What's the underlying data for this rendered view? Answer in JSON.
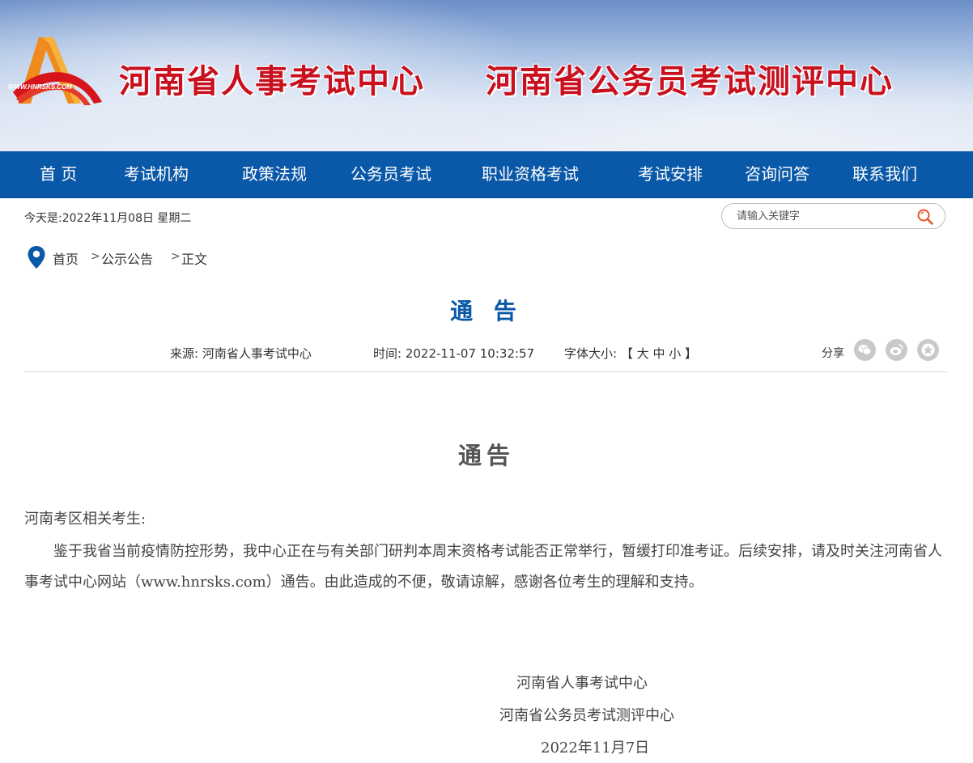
{
  "header": {
    "logo_text": "WWW.HNRSKS.COM",
    "title_1": "河南省人事考试中心",
    "title_2": "河南省公务员考试测评中心"
  },
  "nav": {
    "items": [
      "首 页",
      "考试机构",
      "政策法规",
      "公务员考试",
      "职业资格考试",
      "考试安排",
      "咨询问答",
      "联系我们"
    ]
  },
  "toolbar": {
    "date": "今天是:2022年11月08日 星期二",
    "search_placeholder": "请输入关键字",
    "search_value": ""
  },
  "breadcrumb": {
    "items": [
      "首页",
      "公示公告",
      "正文"
    ],
    "separator": ">"
  },
  "article": {
    "title": "通 告",
    "source": "来源:  河南省人事考试中心",
    "time": "时间:  2022-11-07 10:32:57",
    "font_size_label": "字体大小:",
    "font_size_open": "【",
    "font_size_options": [
      "大",
      "中",
      "小"
    ],
    "font_size_close": "】",
    "share_label": "分享",
    "share_icons": [
      "wechat-icon",
      "weibo-icon",
      "favorite-icon"
    ]
  },
  "content": {
    "title": "通告",
    "salutation": "河南考区相关考生:",
    "body": "鉴于我省当前疫情防控形势，我中心正在与有关部门研判本周末资格考试能否正常举行，暂缓打印准考证。后续安排，请及时关注河南省人事考试中心网站（www.hnrsks.com）通告。由此造成的不便，敬请谅解，感谢各位考生的理解和支持。",
    "signature_1": "河南省人事考试中心",
    "signature_2": "河南省公务员考试测评中心",
    "date": "2022年11月7日"
  },
  "colors": {
    "nav_bg": "#0a58a8",
    "title_red": "#c8101e",
    "article_title_blue": "#0a58a8",
    "search_icon": "#e8542a"
  }
}
